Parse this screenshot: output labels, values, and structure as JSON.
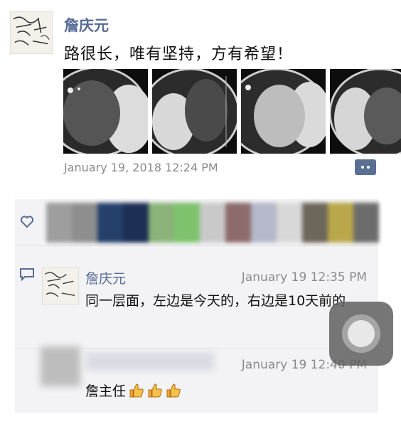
{
  "post": {
    "author": "詹庆元",
    "text": "路很长，唯有坚持，方有希望！",
    "images": [
      "scan-1",
      "scan-2",
      "scan-3",
      "scan-4"
    ],
    "timestamp": "January 19, 2018 12:24 PM",
    "actions_icon": "comment-more-icon"
  },
  "likes": {
    "icon": "heart-icon",
    "tile_colors": [
      "#9e9e9e",
      "#8e8e8e",
      "#24406b",
      "#1d2f55",
      "#8ab47a",
      "#7ec36c",
      "#c9c9c9",
      "#8c6b6b",
      "#b4b8c8",
      "#d8d8d8",
      "#6d665a",
      "#b9a84a",
      "#6c6c6c"
    ]
  },
  "comments": [
    {
      "icon": "comment-bubble-icon",
      "author": "詹庆元",
      "time": "January 19 12:35 PM",
      "text": "同一层面，左边是今天的，右边是10天前的"
    },
    {
      "time": "January 19 12:40 PM",
      "text": "詹主任",
      "emoji": [
        "thumbs-up",
        "thumbs-up",
        "thumbs-up"
      ]
    }
  ],
  "overlay": {
    "icon": "assistive-touch-icon"
  }
}
